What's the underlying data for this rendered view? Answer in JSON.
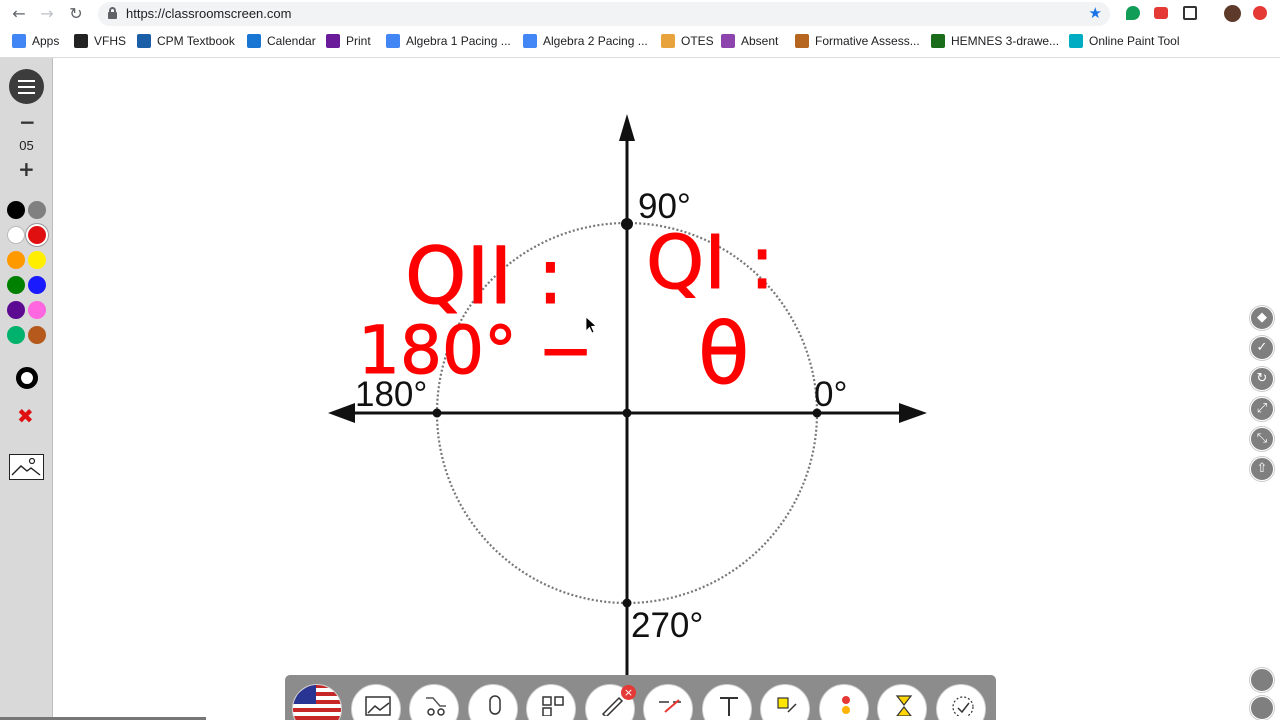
{
  "browser": {
    "url": "https://classroomscreen.com",
    "bookmarks": [
      {
        "label": "Apps",
        "icon": "apps-grid-icon",
        "color": "#4285f4"
      },
      {
        "label": "VFHS",
        "icon": "bb-icon",
        "color": "#222222"
      },
      {
        "label": "CPM Textbook",
        "icon": "cpm-icon",
        "color": "#1a5fa8"
      },
      {
        "label": "Calendar",
        "icon": "calendar-icon",
        "color": "#1976d2"
      },
      {
        "label": "Print",
        "icon": "rsa-icon",
        "color": "#6a1b9a"
      },
      {
        "label": "Algebra 1 Pacing ...",
        "icon": "docs-icon",
        "color": "#4285f4"
      },
      {
        "label": "Algebra 2 Pacing ...",
        "icon": "docs-icon",
        "color": "#4285f4"
      },
      {
        "label": "OTES",
        "icon": "otes-icon",
        "color": "#e8a33d"
      },
      {
        "label": "Absent",
        "icon": "absent-icon",
        "color": "#8e44ad"
      },
      {
        "label": "Formative Assess...",
        "icon": "formative-icon",
        "color": "#b5651d"
      },
      {
        "label": "HEMNES 3-drawe...",
        "icon": "ikea-icon",
        "color": "#1a6b1a"
      },
      {
        "label": "Online Paint Tool",
        "icon": "paint-tool-icon",
        "color": "#00acc1"
      }
    ]
  },
  "draw_panel": {
    "pen_size": "05",
    "colors": [
      "#000000",
      "#808080",
      "#ffffff",
      "#e01010",
      "#ff9900",
      "#ffee00",
      "#008000",
      "#1a1aff",
      "#5b0a91",
      "#ff66e0",
      "#00b26b",
      "#b5591c"
    ],
    "selected_color": "#e01010"
  },
  "diagram": {
    "angle_labels": {
      "top": "90°",
      "left": "180°",
      "right": "0°",
      "bottom": "270°"
    },
    "handwriting": {
      "q2_label": "QII :",
      "q2_formula": "180° −",
      "q1_label": "QI :",
      "q1_formula": "θ",
      "ink_color": "#ff0000"
    }
  },
  "right_tools": [
    "paint-bucket-icon",
    "eraser-clear-icon",
    "refresh-icon",
    "expand-icon",
    "compress-icon",
    "upload-icon"
  ],
  "bottom_tools": [
    "language-flag-icon",
    "background-image-icon",
    "random-name-icon",
    "sound-level-icon",
    "qr-code-icon",
    "draw-icon",
    "work-symbols-icon",
    "text-icon",
    "group-maker-icon",
    "traffic-light-icon",
    "timer-icon",
    "clock-icon"
  ]
}
